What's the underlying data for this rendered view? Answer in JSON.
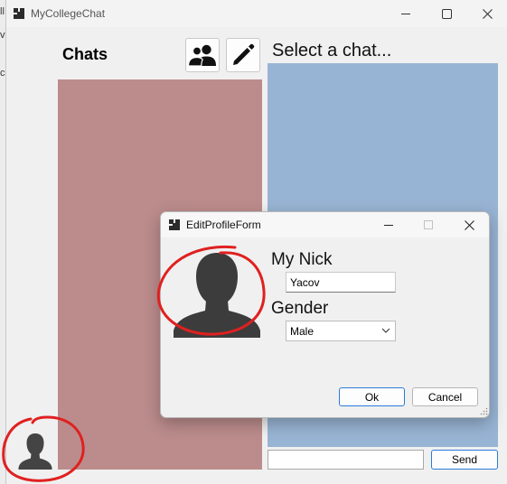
{
  "background_window": {
    "edge_marks": [
      "ll",
      "v",
      "c"
    ]
  },
  "window": {
    "title": "MyCollegeChat",
    "app_icon": "app-grid-icon",
    "controls": [
      "minimize-icon",
      "maximize-icon",
      "close-icon"
    ]
  },
  "sidebar": {
    "chats_label": "Chats",
    "contacts_button_icon": "people-icon",
    "edit_button_icon": "pencil-icon"
  },
  "chat": {
    "header": "Select a chat...",
    "message_placeholder": "",
    "send_label": "Send"
  },
  "colors": {
    "chats_panel": "#bc8c8c",
    "chat_panel": "#98b4d4",
    "accent": "#2b7bd6",
    "annotation": "#e02020"
  },
  "dialog": {
    "title": "EditProfileForm",
    "nick_label": "My Nick",
    "nick_value": "Yacov",
    "gender_label": "Gender",
    "gender_value": "Male",
    "ok_label": "Ok",
    "cancel_label": "Cancel"
  }
}
